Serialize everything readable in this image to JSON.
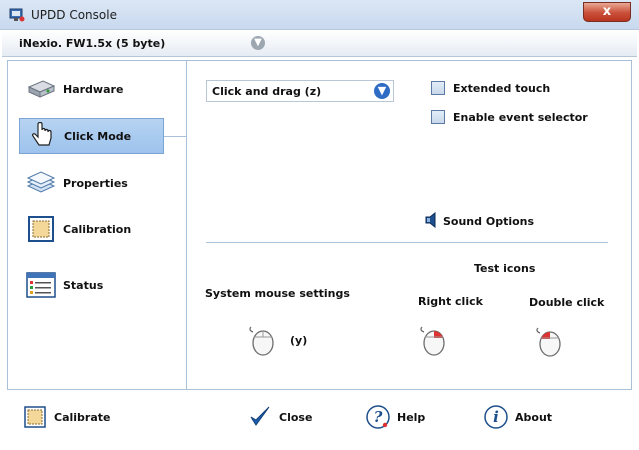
{
  "window": {
    "title": "UPDD Console",
    "close_glyph": "x",
    "app_icon": "monitor-icon"
  },
  "device": {
    "selected": "iNexio. FW1.5x (5 byte)",
    "dropdown_glyph": "▼"
  },
  "sidebar": {
    "items": [
      {
        "label": "Hardware",
        "icon": "hardware-icon"
      },
      {
        "label": "Click Mode",
        "icon": "pointing-hand-icon",
        "selected": true
      },
      {
        "label": "Properties",
        "icon": "layers-icon"
      },
      {
        "label": "Calibration",
        "icon": "calibration-icon"
      },
      {
        "label": "Status",
        "icon": "status-icon"
      }
    ]
  },
  "click_mode": {
    "mode_value": "Click and drag (z)",
    "dropdown_glyph": "▼",
    "extended_touch_label": "Extended touch",
    "extended_touch_checked": false,
    "event_selector_label": "Enable event selector",
    "event_selector_checked": false,
    "sound_options_label": "Sound Options",
    "system_mouse_label": "System mouse settings",
    "system_mouse_key": "(y)",
    "test_icons_label": "Test icons",
    "right_click_label": "Right click",
    "double_click_label": "Double click"
  },
  "bottom": {
    "calibrate_label": "Calibrate",
    "close_label": "Close",
    "help_label": "Help",
    "about_label": "About"
  },
  "colors": {
    "accent_blue": "#2f6dc5",
    "selection": "#b7d3f2",
    "close_button": "#c9503a",
    "border": "#a9c0d9"
  }
}
